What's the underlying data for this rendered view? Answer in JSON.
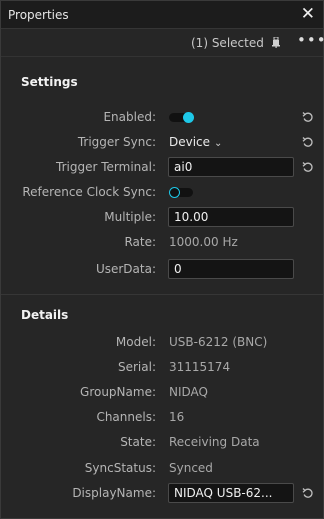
{
  "window": {
    "title": "Properties"
  },
  "toolbar": {
    "selection_label": "(1) Selected"
  },
  "settings": {
    "title": "Settings",
    "enabled": {
      "label": "Enabled:",
      "on": true
    },
    "trigger_sync": {
      "label": "Trigger Sync:",
      "value": "Device"
    },
    "trigger_terminal": {
      "label": "Trigger Terminal:",
      "value": "ai0"
    },
    "reference_clock_sync": {
      "label": "Reference Clock Sync:",
      "on": false
    },
    "multiple": {
      "label": "Multiple:",
      "value": "10.00"
    },
    "rate": {
      "label": "Rate:",
      "value": "1000.00 Hz"
    },
    "user_data": {
      "label": "UserData:",
      "value": "0"
    }
  },
  "details": {
    "title": "Details",
    "model": {
      "label": "Model:",
      "value": "USB-6212 (BNC)"
    },
    "serial": {
      "label": "Serial:",
      "value": "31115174"
    },
    "group_name": {
      "label": "GroupName:",
      "value": "NIDAQ"
    },
    "channels": {
      "label": "Channels:",
      "value": "16"
    },
    "state": {
      "label": "State:",
      "value": "Receiving Data"
    },
    "sync_status": {
      "label": "SyncStatus:",
      "value": "Synced"
    },
    "display_name": {
      "label": "DisplayName:",
      "value": "NIDAQ USB-62..."
    }
  },
  "colors": {
    "accent": "#1ec8e8",
    "panel": "#262626",
    "titlebar": "#1c1c1c"
  },
  "icons": [
    "close-icon",
    "pin-icon",
    "more-icon",
    "reset-icon",
    "chevron-down-icon"
  ]
}
